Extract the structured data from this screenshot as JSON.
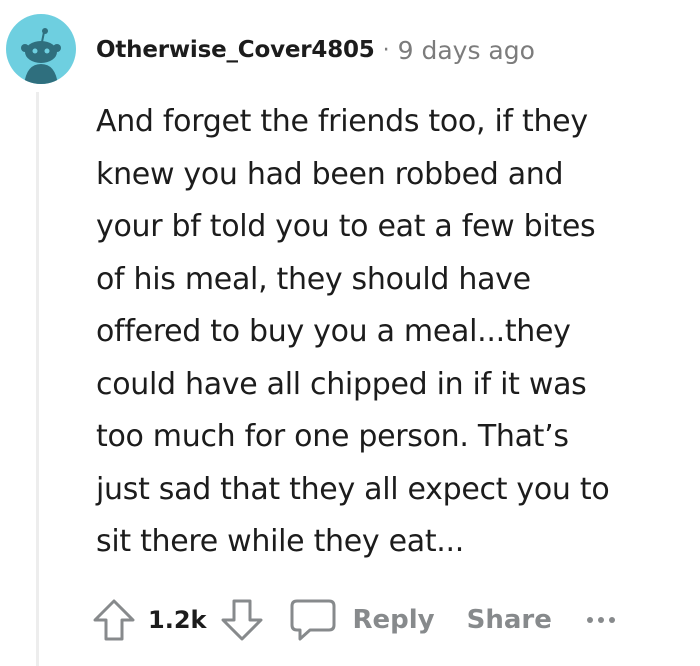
{
  "comment": {
    "author": "Otherwise_Cover4805",
    "separator": "·",
    "timestamp": "9 days ago",
    "body_lines": [
      "And forget the friends too, if they",
      "knew you had been robbed and",
      "your bf told you to eat a few bites",
      "of his meal, they should have",
      "offered to buy you a meal...they",
      "could have all chipped in if it was",
      "too much for one person. That’s",
      "just sad that they all expect you to",
      "sit there while they eat..."
    ],
    "avatar_color": "#6ecfe0"
  },
  "actions": {
    "vote_count": "1.2k",
    "reply_label": "Reply",
    "share_label": "Share"
  },
  "icons": {
    "upvote": "upvote-arrow-icon",
    "downvote": "downvote-arrow-icon",
    "reply": "speech-bubble-icon",
    "more": "more-options-icon"
  }
}
